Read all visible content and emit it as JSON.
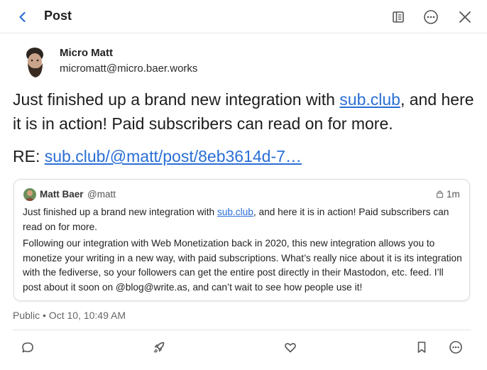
{
  "header": {
    "title": "Post",
    "back_icon": "chevron-left-icon",
    "reader_icon": "reader-view-icon",
    "more_icon": "more-horizontal-icon",
    "close_icon": "close-icon"
  },
  "author": {
    "name": "Micro Matt",
    "handle": "micromatt@micro.baer.works"
  },
  "post": {
    "text_before": "Just finished up a brand new integration with ",
    "link_text": "sub.club",
    "text_after": ", and here it is in action! Paid subscribers can read on for more.",
    "re_label": "RE: ",
    "re_link": "sub.club/@matt/post/8eb3614d-7…"
  },
  "quote": {
    "name": "Matt Baer",
    "handle": "@matt",
    "time": "1m",
    "p1_before": "Just finished up a brand new integration with ",
    "p1_link": "sub.club",
    "p1_after": ", and here it is in action! Paid subscribers can read on for more.",
    "p2": "Following our integration with Web Monetization back in 2020, this new integration allows you to monetize your writing in a new way, with paid subscriptions. What’s really nice about it is its integration with the fediverse, so your followers can get the entire post directly in their Mastodon, etc. feed. I’ll post about it soon on @blog@write.as, and can’t wait to see how people use it!"
  },
  "meta": {
    "text": "Public • Oct 10, 10:49 AM"
  },
  "actions": [
    "reply-icon",
    "boost-rocket-icon",
    "like-heart-icon",
    "bookmark-icon",
    "more-horizontal-icon"
  ],
  "colors": {
    "link": "#2a6fd6",
    "back_chevron": "#2a6fd6",
    "icon": "#555555"
  }
}
